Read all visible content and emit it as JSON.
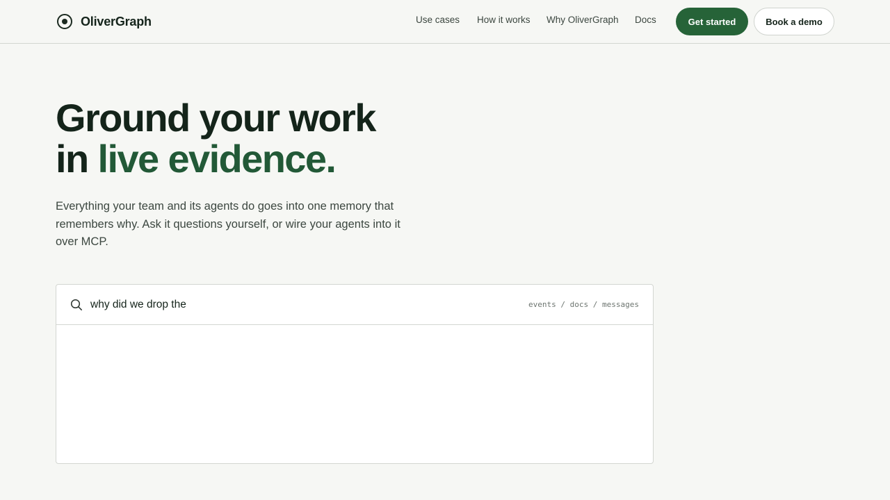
{
  "brand": {
    "name": "OliverGraph",
    "logo_icon": "target-icon"
  },
  "nav": {
    "items": [
      "Use cases",
      "How it works",
      "Why OliverGraph",
      "Docs"
    ],
    "cta_primary": "Get started",
    "cta_secondary": "Book a demo"
  },
  "hero": {
    "title_line1": "Ground your work",
    "title_line2_prefix": "in ",
    "title_line2_accent": "live evidence.",
    "subtitle": "Everything your team and its agents do goes into one memory that remembers why. Ask it questions yourself, or wire your agents into it over MCP."
  },
  "search": {
    "icon": "search-icon",
    "value": "why did we drop the",
    "scope": "events / docs / messages"
  },
  "colors": {
    "accent": "#266338",
    "accent_text": "#225937",
    "background": "#f6f7f4"
  }
}
